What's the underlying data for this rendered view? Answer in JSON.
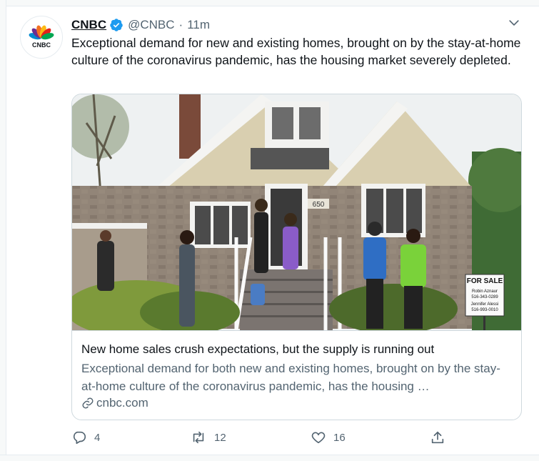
{
  "tweet": {
    "author_name": "CNBC",
    "avatar_text": "CNBC",
    "handle": "@CNBC",
    "separator": "·",
    "time": "11m",
    "text": "Exceptional demand for new and existing homes, brought on by the stay-at-home culture of the coronavirus pandemic, has the housing market severely depleted."
  },
  "card": {
    "photo_sign": [
      "FOR SALE",
      "Robin Aznaur",
      "516-343-0289",
      "Jennifer Alessi",
      "516-993-0010"
    ],
    "house_number": "650",
    "title": "New home sales crush expectations, but the supply is running out",
    "description": "Exceptional demand for both new and existing homes, brought on by the stay-at-home culture of the coronavirus pandemic, has the housing …",
    "domain": "cnbc.com"
  },
  "actions": {
    "replies": "4",
    "retweets": "12",
    "likes": "16"
  },
  "colors": {
    "text": "#0f1419",
    "muted": "#536471",
    "verified": "#1d9bf0",
    "border": "#cfd9de"
  },
  "icons": [
    "verified-badge-icon",
    "chevron-down-icon",
    "link-icon",
    "reply-icon",
    "retweet-icon",
    "like-icon",
    "share-icon"
  ]
}
